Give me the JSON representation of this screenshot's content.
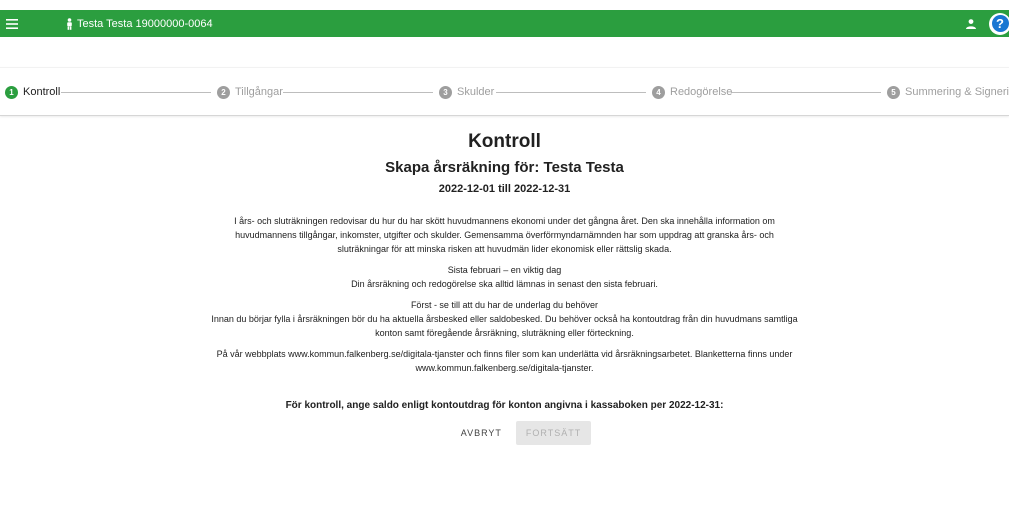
{
  "header": {
    "user_title": "Testa Testa 19000000-0064",
    "icons": [
      "menu-icon",
      "person-icon",
      "account-icon",
      "help-icon"
    ],
    "help_symbol": "?"
  },
  "stepper": {
    "steps": [
      {
        "number": "1",
        "label": "Kontroll",
        "state": "active"
      },
      {
        "number": "2",
        "label": "Tillgångar",
        "state": "inactive"
      },
      {
        "number": "3",
        "label": "Skulder",
        "state": "inactive"
      },
      {
        "number": "4",
        "label": "Redogörelse",
        "state": "inactive"
      },
      {
        "number": "5",
        "label": "Summering & Signering",
        "state": "inactive"
      }
    ]
  },
  "main": {
    "title": "Kontroll",
    "subtitle": "Skapa årsräkning för: Testa Testa",
    "period": "2022-12-01 till 2022-12-31",
    "paragraph1_line1": "I års- och sluträkningen redovisar du hur du har skött huvudmannens ekonomi under det gångna året. Den ska innehålla information om",
    "paragraph1_line2": "huvudmannens tillgångar, inkomster, utgifter och skulder. Gemensamma överförmyndarnämnden har som uppdrag att granska års- och",
    "paragraph1_line3": "sluträkningar för att minska risken att huvudmän lider ekonomisk eller rättslig skada.",
    "paragraph2_line1": "Sista februari – en viktig dag",
    "paragraph2_line2": "Din årsräkning och redogörelse ska alltid lämnas in senast den sista februari.",
    "paragraph3_line1": "Först - se till att du har de underlag du behöver",
    "paragraph3_line2": "Innan du börjar fylla i årsräkningen bör du ha aktuella årsbesked eller saldobesked. Du behöver också ha kontoutdrag från din huvudmans samtliga",
    "paragraph3_line3": "konton samt föregående årsräkning, sluträkning eller förteckning.",
    "paragraph4_line1": "På vår webbplats www.kommun.falkenberg.se/digitala-tjanster och finns filer som kan underlätta vid årsräkningsarbetet. Blanketterna finns under",
    "paragraph4_line2": "www.kommun.falkenberg.se/digitala-tjanster.",
    "control_text": "För kontroll, ange saldo enligt kontoutdrag för konton angivna i kassaboken per 2022-12-31:",
    "cancel_label": "AVBRYT",
    "next_label": "FORTSÄTT",
    "next_disabled": true
  },
  "colors": {
    "header_green": "#2b9e3f",
    "help_blue": "#1976d2",
    "step_inactive": "#9e9e9e"
  }
}
